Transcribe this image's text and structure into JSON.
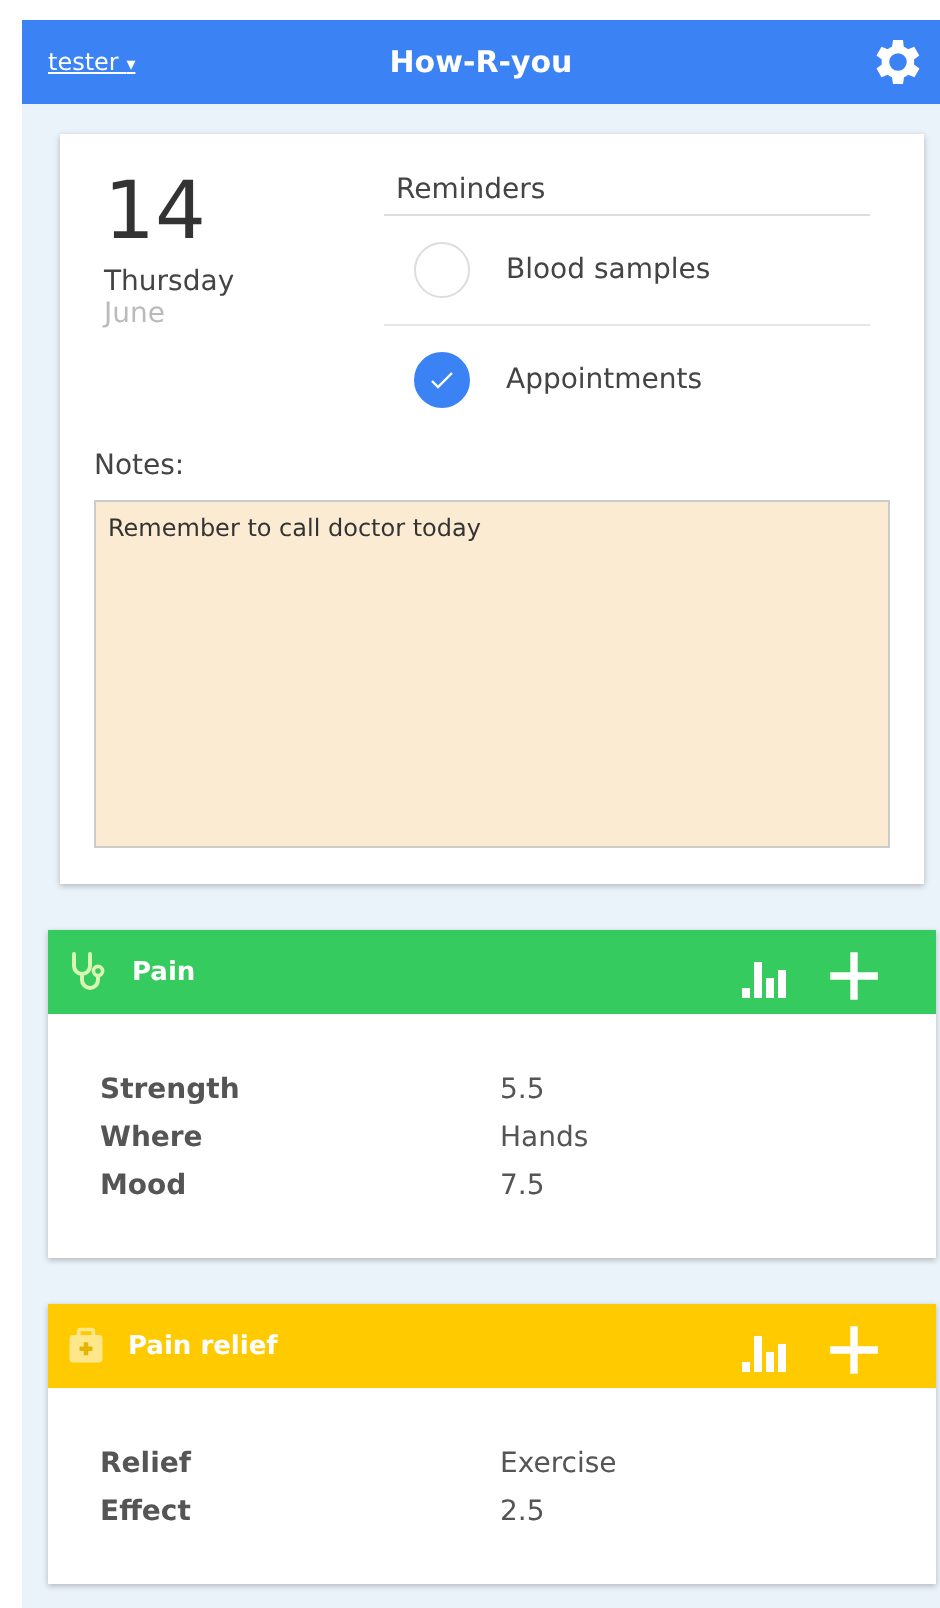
{
  "header": {
    "user": "tester",
    "user_caret": "▾",
    "title": "How-R-you"
  },
  "day": {
    "number": "14",
    "weekday": "Thursday",
    "month": "June"
  },
  "reminders": {
    "title": "Reminders",
    "items": [
      {
        "label": "Blood samples",
        "checked": false
      },
      {
        "label": "Appointments",
        "checked": true
      }
    ]
  },
  "notes": {
    "label": "Notes:",
    "value": "Remember to call doctor today"
  },
  "cards": [
    {
      "title": "Pain",
      "kind": "stethoscope",
      "color": "#35cb5f",
      "rows": [
        {
          "label": "Strength",
          "value": "5.5"
        },
        {
          "label": "Where",
          "value": "Hands"
        },
        {
          "label": "Mood",
          "value": "7.5"
        }
      ]
    },
    {
      "title": "Pain relief",
      "kind": "medkit",
      "color": "#ffcb00",
      "rows": [
        {
          "label": "Relief",
          "value": "Exercise"
        },
        {
          "label": "Effect",
          "value": "2.5"
        }
      ]
    }
  ]
}
